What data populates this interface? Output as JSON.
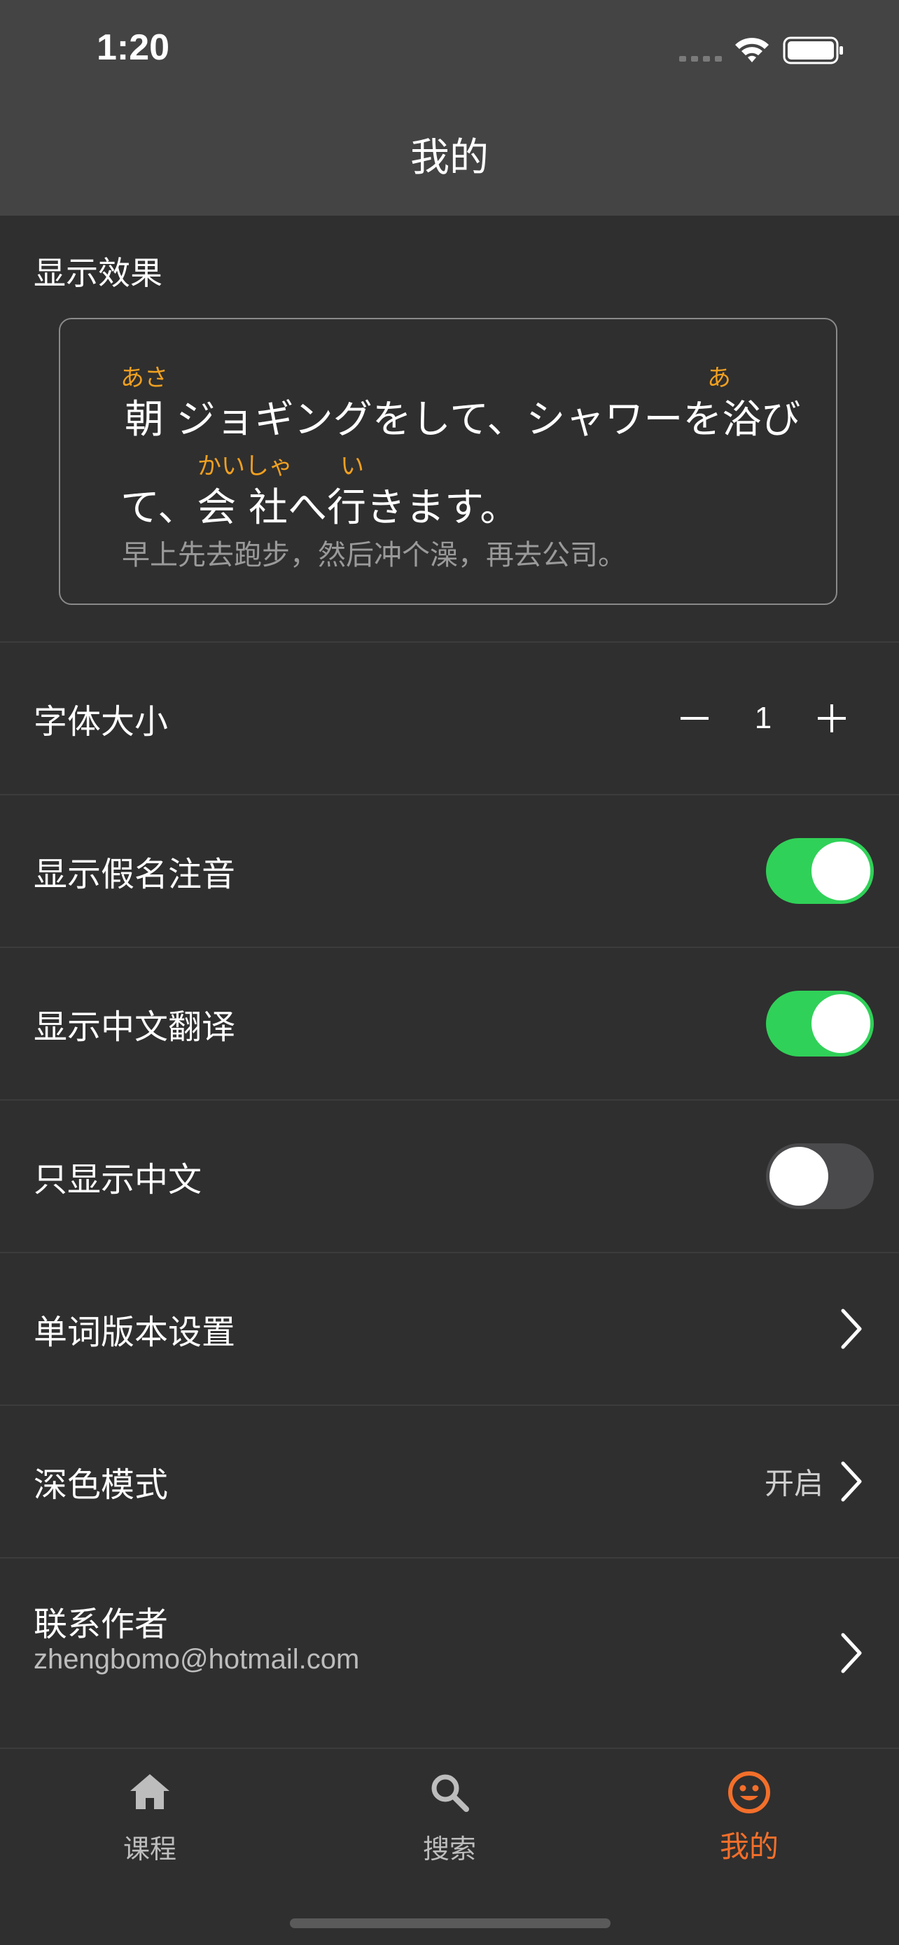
{
  "status_bar": {
    "time": "1:20"
  },
  "header": {
    "title": "我的"
  },
  "display_effect": {
    "section_title": "显示效果",
    "line1": "朝 ジョギングをして、シャワーを浴び",
    "line1_ruby_1": "あさ",
    "line1_ruby_2": "あ",
    "line2": "て、会 社へ行きます。",
    "line2_ruby_1": "かいしゃ",
    "line2_ruby_2": "い",
    "translation": "早上先去跑步，然后冲个澡，再去公司。"
  },
  "settings": {
    "font_size": {
      "label": "字体大小",
      "value": "1"
    },
    "show_kana": {
      "label": "显示假名注音",
      "on": true
    },
    "show_chinese": {
      "label": "显示中文翻译",
      "on": true
    },
    "chinese_only": {
      "label": "只显示中文",
      "on": false
    },
    "word_version": {
      "label": "单词版本设置"
    },
    "dark_mode": {
      "label": "深色模式",
      "value": "开启"
    },
    "contact": {
      "label": "联系作者",
      "email": "zhengbomo@hotmail.com"
    }
  },
  "tabs": [
    {
      "label": "课程",
      "icon": "home-icon",
      "active": false
    },
    {
      "label": "搜索",
      "icon": "search-icon",
      "active": false
    },
    {
      "label": "我的",
      "icon": "smiley-icon",
      "active": true
    }
  ],
  "colors": {
    "accent": "#f36f2a",
    "toggle_on": "#30d158",
    "ruby": "#f0a020",
    "background": "#2f2f2f",
    "header": "#444444"
  }
}
